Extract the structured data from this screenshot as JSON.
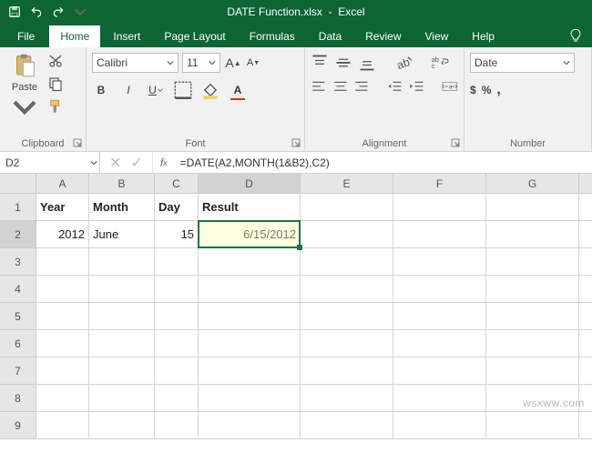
{
  "titlebar": {
    "filename": "DATE Function.xlsx",
    "app": "Excel"
  },
  "tabs": {
    "file": "File",
    "home": "Home",
    "insert": "Insert",
    "page_layout": "Page Layout",
    "formulas": "Formulas",
    "data": "Data",
    "review": "Review",
    "view": "View",
    "help": "Help"
  },
  "ribbon": {
    "clipboard": {
      "label": "Clipboard",
      "paste": "Paste"
    },
    "font": {
      "label": "Font",
      "name": "Calibri",
      "size": "11",
      "increase": "A",
      "decrease": "A",
      "bold": "B",
      "italic": "I",
      "underline": "U"
    },
    "alignment": {
      "label": "Alignment"
    },
    "number": {
      "label": "Number",
      "format": "Date"
    }
  },
  "namebox": "D2",
  "formula": "=DATE(A2,MONTH(1&B2),C2)",
  "columns": [
    "A",
    "B",
    "C",
    "D",
    "E",
    "F",
    "G"
  ],
  "rows": [
    "1",
    "2",
    "3",
    "4",
    "5",
    "6",
    "7",
    "8",
    "9"
  ],
  "headers": {
    "A1": "Year",
    "B1": "Month",
    "C1": "Day",
    "D1": "Result"
  },
  "data": {
    "A2": "2012",
    "B2": "June",
    "C2": "15",
    "D2": "6/15/2012"
  },
  "selected": {
    "col": "D",
    "row": "2",
    "cell": "D2"
  },
  "watermark": "wsxww.com",
  "chart_data": null
}
